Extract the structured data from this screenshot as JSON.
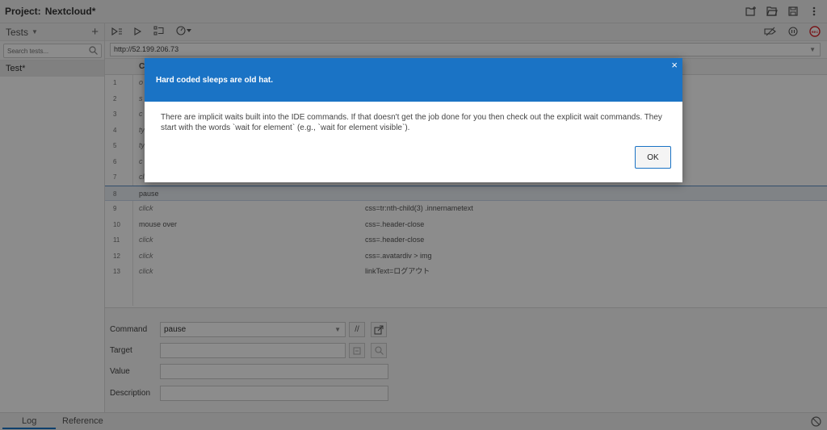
{
  "header": {
    "project_label": "Project:",
    "project_name": "Nextcloud*"
  },
  "sidebar": {
    "title": "Tests",
    "add_label": "+",
    "search_placeholder": "Search tests...",
    "tests": [
      "Test*"
    ]
  },
  "url_bar": {
    "value": "http://52.199.206.73"
  },
  "table": {
    "header_command": "C",
    "rows": [
      {
        "num": "1",
        "command": "o",
        "target": ""
      },
      {
        "num": "2",
        "command": "s",
        "target": ""
      },
      {
        "num": "3",
        "command": "c",
        "target": ""
      },
      {
        "num": "4",
        "command": "ty",
        "target": ""
      },
      {
        "num": "5",
        "command": "ty",
        "target": ""
      },
      {
        "num": "6",
        "command": "c",
        "target": ""
      },
      {
        "num": "7",
        "command": "cl",
        "target": ""
      },
      {
        "num": "8",
        "command": "pause",
        "target": ""
      },
      {
        "num": "9",
        "command": "click",
        "target": "css=tr:nth-child(3) .innernametext"
      },
      {
        "num": "10",
        "command": "mouse over",
        "target": "css=.header-close"
      },
      {
        "num": "11",
        "command": "click",
        "target": "css=.header-close"
      },
      {
        "num": "12",
        "command": "click",
        "target": "css=.avatardiv > img"
      },
      {
        "num": "13",
        "command": "click",
        "target": "linkText=ログアウト"
      }
    ]
  },
  "editor": {
    "command_label": "Command",
    "command_value": "pause",
    "comment_btn": "//",
    "target_label": "Target",
    "target_value": "",
    "value_label": "Value",
    "value_value": "",
    "description_label": "Description",
    "description_value": ""
  },
  "bottom": {
    "tab_log": "Log",
    "tab_reference": "Reference"
  },
  "dialog": {
    "title": "Hard coded sleeps are old hat.",
    "close": "×",
    "body": "There are implicit waits built into the IDE commands. If that doesn't get the job done for you then check out the explicit wait commands. They start with the words `wait for element` (e.g., `wait for element visible`).",
    "ok_label": "OK"
  },
  "colors": {
    "accent": "#1a73c5",
    "record": "#d9262b"
  }
}
